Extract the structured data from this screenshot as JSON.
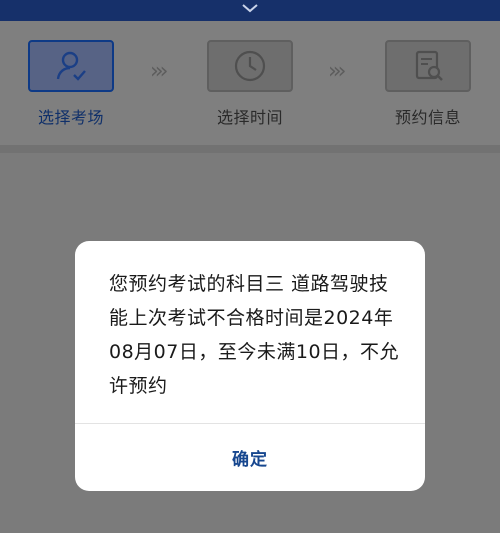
{
  "steps": [
    {
      "label": "选择考场",
      "icon": "user-check-icon",
      "active": true
    },
    {
      "label": "选择时间",
      "icon": "clock-icon",
      "active": false
    },
    {
      "label": "预约信息",
      "icon": "document-search-icon",
      "active": false
    }
  ],
  "dialog": {
    "message": "您预约考试的科目三 道路驾驶技能上次考试不合格时间是2024年08月07日，至今未满10日，不允许预约",
    "ok_label": "确定"
  },
  "colors": {
    "accent": "#17478f",
    "topbar": "#16306a"
  }
}
